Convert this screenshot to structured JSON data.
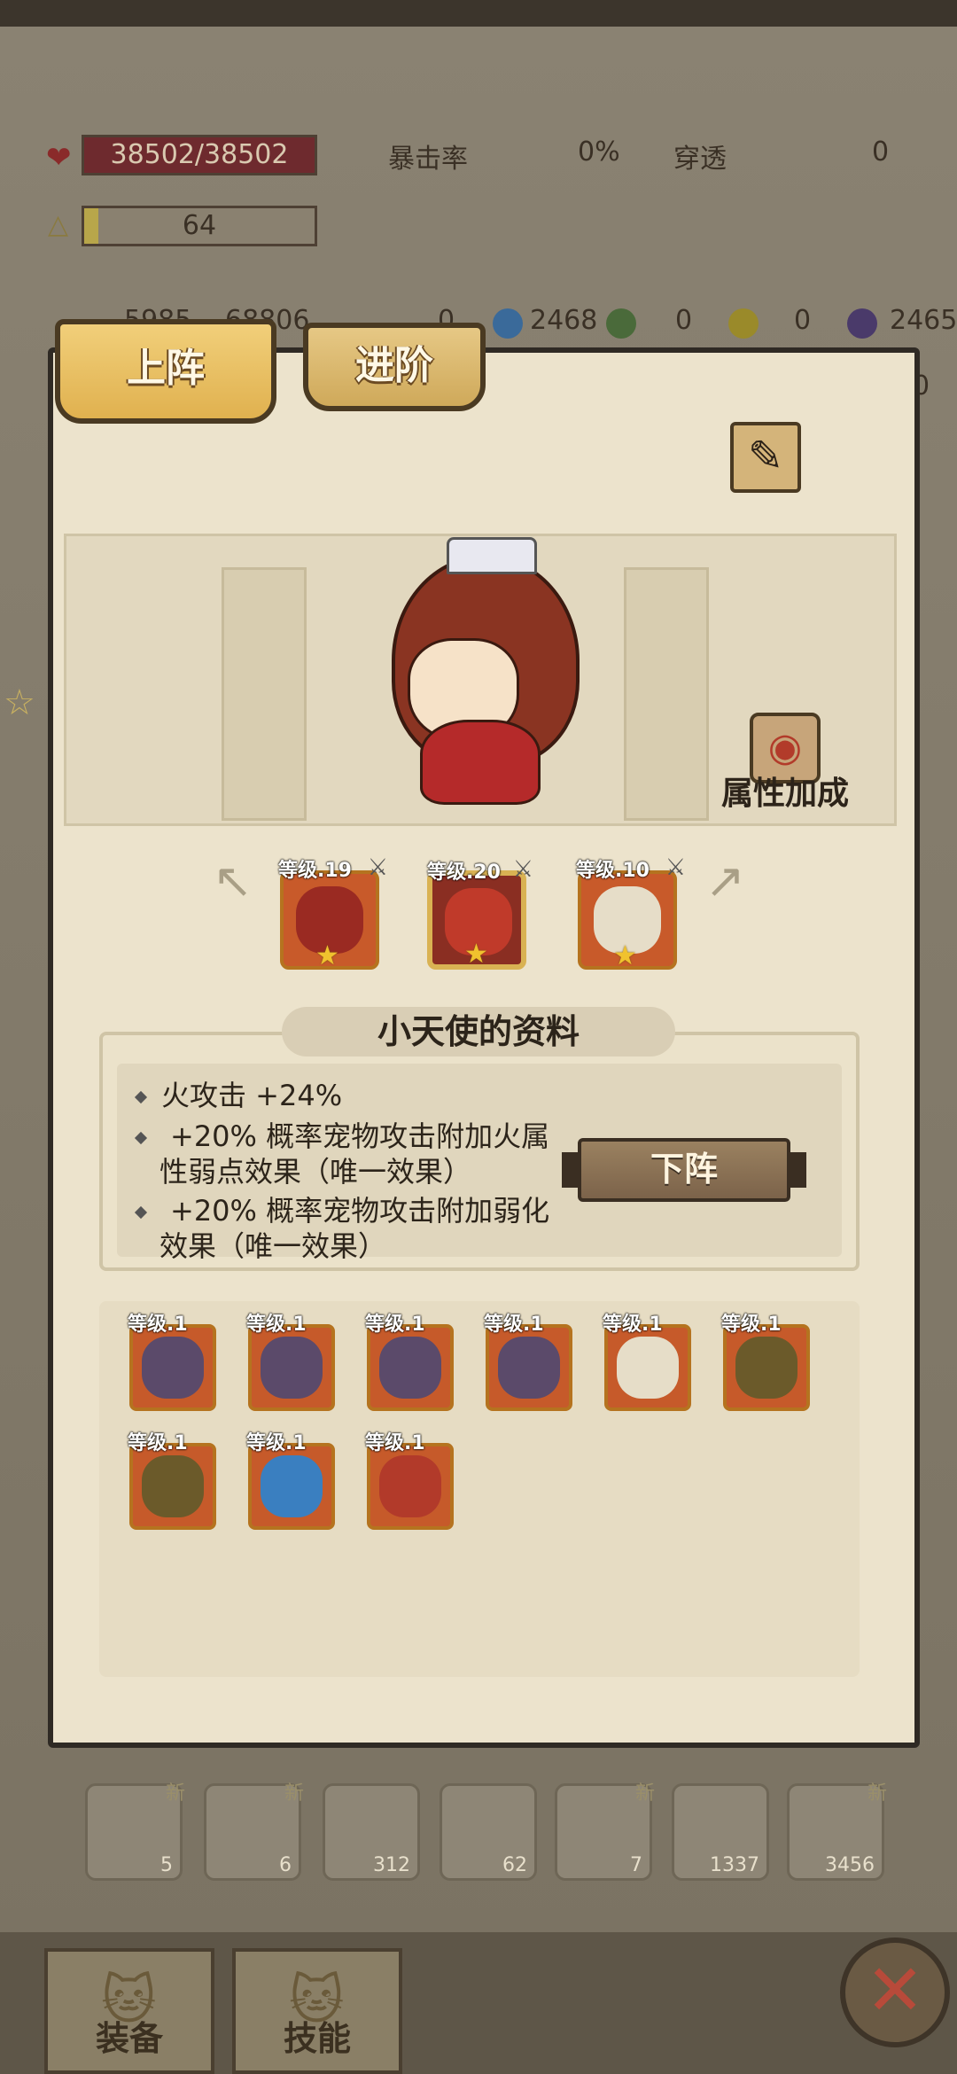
{
  "background_stats": {
    "hp": "38502/38502",
    "level": "64",
    "crit_label": "暴击率",
    "crit_value": "0%",
    "pierce_label": "穿透",
    "pierce_value": "0",
    "row3": [
      "5985",
      "68806",
      "0",
      "2468",
      "0",
      "0",
      "2465",
      "0"
    ]
  },
  "tabs": {
    "deploy": "上阵",
    "advance": "进阶"
  },
  "attribute_bonus_label": "属性加成",
  "equipped_pets": [
    {
      "level": "等级.19",
      "name": "axe-pet",
      "color": "#9a2a22"
    },
    {
      "level": "等级.20",
      "name": "red-dragon-pet",
      "color": "#7a1e1a",
      "selected": true
    },
    {
      "level": "等级.10",
      "name": "winged-shield-pet",
      "color": "#d8d0c0"
    }
  ],
  "info": {
    "title": "小天使的资料",
    "bonuses": [
      "火攻击 +24%",
      "+20% 概率宠物攻击附加火属",
      "性弱点效果（唯一效果）",
      "+20% 概率宠物攻击附加弱化",
      "效果（唯一效果）"
    ],
    "remove_button": "下阵"
  },
  "inventory": [
    {
      "level": "等级.1",
      "name": "rock-golem-pet",
      "color": "#5b4a6a"
    },
    {
      "level": "等级.1",
      "name": "rock-golem-pet",
      "color": "#5b4a6a"
    },
    {
      "level": "等级.1",
      "name": "rock-golem-pet",
      "color": "#5b4a6a"
    },
    {
      "level": "等级.1",
      "name": "rock-golem-pet",
      "color": "#5b4a6a"
    },
    {
      "level": "等级.1",
      "name": "winged-shield-pet",
      "color": "#d8d0c0"
    },
    {
      "level": "等级.1",
      "name": "mandrake-pet",
      "color": "#6b5a2a"
    },
    {
      "level": "等级.1",
      "name": "mandrake-pet",
      "color": "#6b5a2a"
    },
    {
      "level": "等级.1",
      "name": "blue-dragon-pet",
      "color": "#3a7fc0"
    },
    {
      "level": "等级.1",
      "name": "red-dragon-pet",
      "color": "#b23a2a"
    }
  ],
  "bg_items": [
    {
      "count": "5",
      "new": "新"
    },
    {
      "count": "6",
      "new": "新"
    },
    {
      "count": "312",
      "new": ""
    },
    {
      "count": "62",
      "new": ""
    },
    {
      "count": "7",
      "new": "新"
    },
    {
      "count": "1337",
      "new": ""
    },
    {
      "count": "3456",
      "new": "新"
    }
  ],
  "bottom_tabs": {
    "equipment": "装备",
    "skills": "技能"
  },
  "close_symbol": "✕",
  "arrow_symbol": "↖",
  "star_symbol": "★"
}
